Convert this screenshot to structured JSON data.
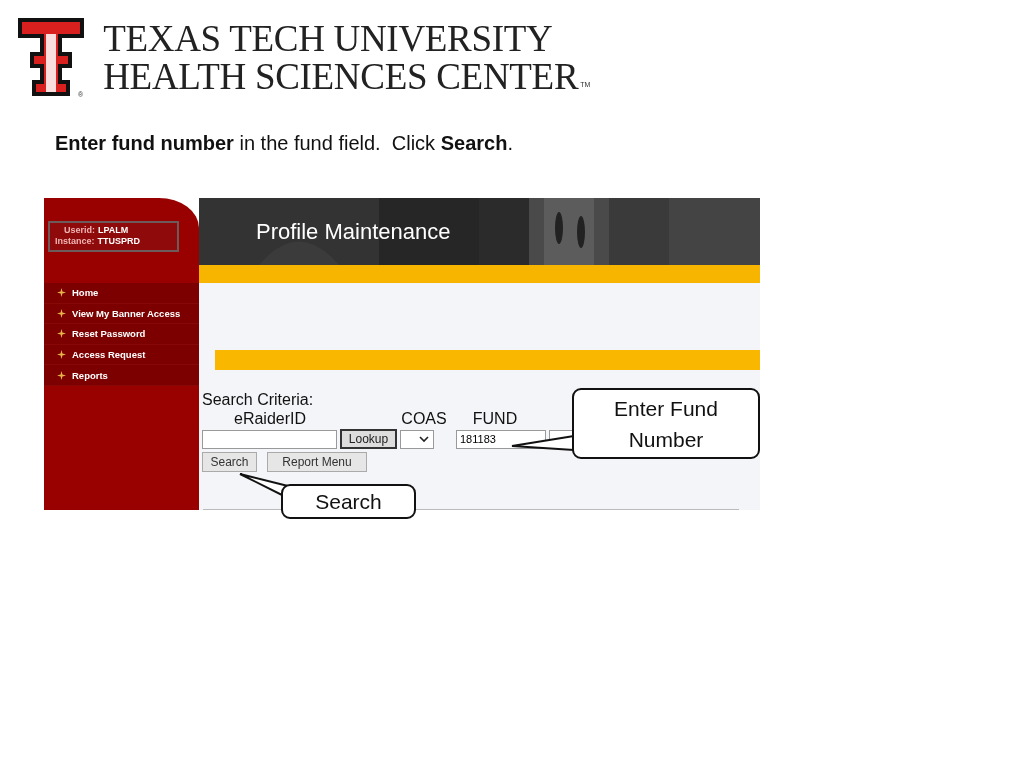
{
  "logo": {
    "line_1": "TEXAS TECH UNIVERSITY",
    "line_2": "HEALTH SCIENCES CENTER",
    "trademark": "TM",
    "registered": "®"
  },
  "instruction": "**Enter fund number** in the fund field.  Click **Search**.",
  "app": {
    "user_info": [
      {
        "label": "Userid:",
        "value": "LPALM"
      },
      {
        "label": "Instance:",
        "value": "TTUSPRD"
      }
    ],
    "nav": [
      "Home",
      "View My Banner Access",
      "Reset Password",
      "Access Request",
      "Reports"
    ],
    "page_title": "Profile Maintenance",
    "search": {
      "heading": "Search Criteria:",
      "eraider_label": "eRaiderID",
      "lookup_button": "Lookup",
      "coas_label": "COAS",
      "fund_label": "FUND",
      "fund_value": "181183",
      "buttons": [
        "Search",
        "Report Menu"
      ]
    }
  },
  "callouts": [
    {
      "text": "Enter Fund Number"
    },
    {
      "text": "Search"
    }
  ]
}
